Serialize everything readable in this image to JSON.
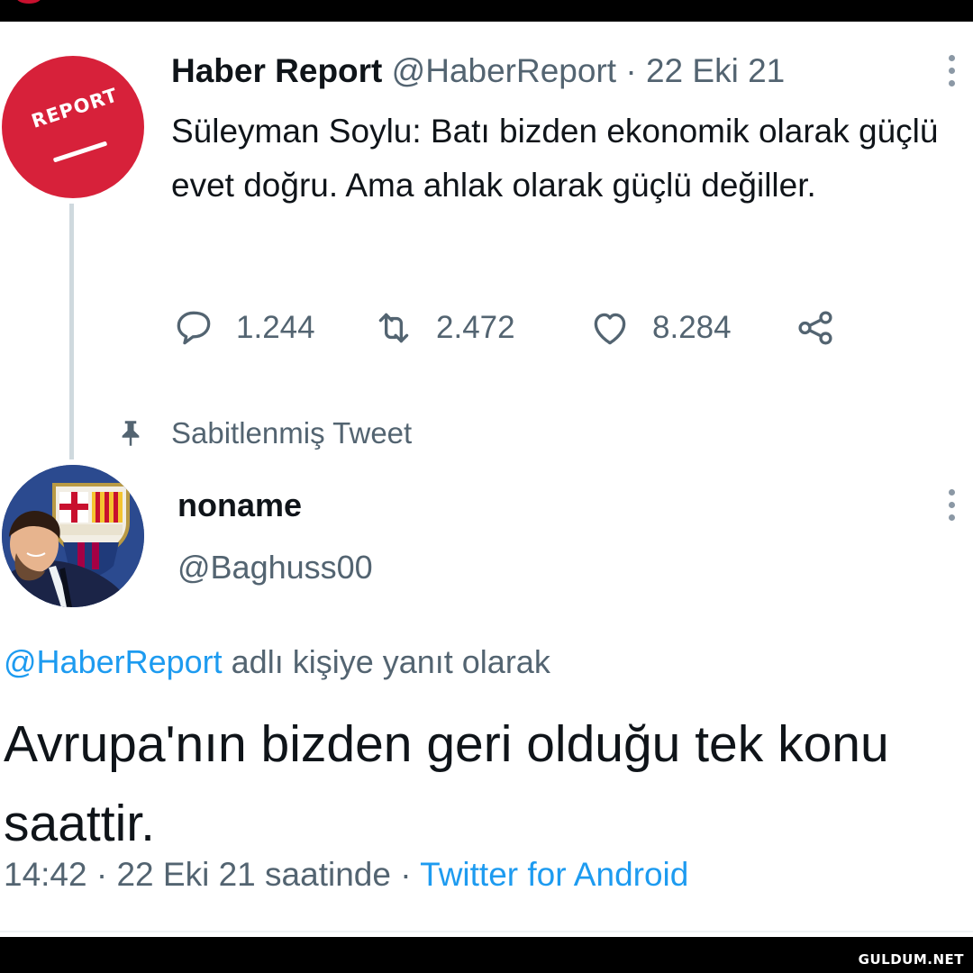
{
  "pinned_tweet": {
    "display_name": "Haber Report",
    "handle": "@HaberReport",
    "separator": "·",
    "date": "22 Eki 21",
    "avatar_text": "REPORT",
    "text": "Süleyman Soylu: Batı bizden ekonomik olarak güçlü evet doğru. Ama ahlak olarak güçlü değiller.",
    "replies": "1.244",
    "retweets": "2.472",
    "likes": "8.284",
    "pinned_label": "Sabitlenmiş Tweet"
  },
  "reply_tweet": {
    "display_name": "noname",
    "handle": "@Baghuss00",
    "reply_context": {
      "mention": "@HaberReport",
      "suffix": " adlı kişiye yanıt olarak"
    },
    "text": "Avrupa'nın bizden geri olduğu tek konu saattir.",
    "time": "14:42",
    "separator": "·",
    "date_text": "22 Eki 21 saatinde",
    "source": "Twitter for Android"
  },
  "watermark": "GULDUM.NET",
  "colors": {
    "accent": "#1d9bf0",
    "secondary_text": "#536471",
    "report_red": "#d7213a"
  },
  "icons": [
    "reply-icon",
    "retweet-icon",
    "like-icon",
    "share-icon",
    "pin-icon",
    "more-icon"
  ]
}
